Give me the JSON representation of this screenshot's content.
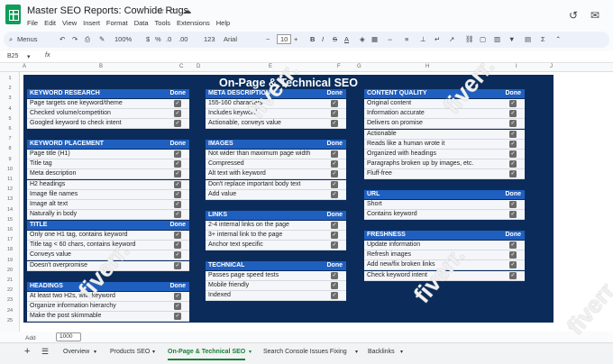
{
  "app": {
    "title": "Master SEO Reports: Cowhide Rugs"
  },
  "menu": [
    "File",
    "Edit",
    "View",
    "Insert",
    "Format",
    "Data",
    "Tools",
    "Extensions",
    "Help"
  ],
  "toolbar": {
    "menus_label": "Menus",
    "zoom": "100%",
    "percent": "%",
    "dec0": ".0",
    "dec00": ".00",
    "num_format": "123",
    "font": "Arial",
    "font_size": "10"
  },
  "formula": {
    "cell_ref": "B25"
  },
  "columns": [
    "A",
    "B",
    "C",
    "D",
    "E",
    "F",
    "G",
    "H",
    "I",
    "J"
  ],
  "rows": [
    "1",
    "2",
    "3",
    "4",
    "5",
    "6",
    "7",
    "8",
    "9",
    "10",
    "11",
    "12",
    "13",
    "14",
    "15",
    "16",
    "17",
    "18",
    "19",
    "20",
    "21",
    "22",
    "23",
    "24",
    "25"
  ],
  "sheet": {
    "title": "On-Page & Technical SEO",
    "done_label": "Done"
  },
  "sections": {
    "keyword_research": {
      "title": "KEYWORD RESEARCH",
      "items": [
        "Page targets one keyword/theme",
        "Checked volume/competition",
        "Googled keyword to check intent"
      ]
    },
    "keyword_placement": {
      "title": "KEYWORD PLACEMENT",
      "items": [
        "Page title (H1)",
        "Title tag",
        "Meta description",
        "H2 headings",
        "Image file names",
        "Image alt text",
        "Naturally in body"
      ]
    },
    "title": {
      "title": "TITLE",
      "items": [
        "Only one H1 tag, contains keyword",
        "Title tag < 60 chars, contains keyword",
        "Conveys value",
        "Doesn't overpromise"
      ]
    },
    "headings": {
      "title": "HEADINGS",
      "items": [
        "At least two H2s, with keyword",
        "Organize information hierarchy",
        "Make the post skimmable"
      ]
    },
    "meta_description": {
      "title": "META DESCRIPTION",
      "items": [
        "155-160 characters",
        "Includes keyword",
        "Actionable, conveys value"
      ]
    },
    "images": {
      "title": "IMAGES",
      "items": [
        "Not wider than maximum page width",
        "Compressed",
        "Alt text with keyword",
        "Don't replace important body text",
        "Add value"
      ]
    },
    "links": {
      "title": "LINKS",
      "items": [
        "2-4 internal links on the page",
        "3+ internal link to the page",
        "Anchor text specific"
      ]
    },
    "technical": {
      "title": "TECHNICAL",
      "items": [
        "Passes page speed tests",
        "Mobile friendly",
        "Indexed"
      ]
    },
    "content_quality": {
      "title": "CONTENT QUALITY",
      "items": [
        "Original content",
        "Information accurate",
        "Delivers on promise",
        "Actionable",
        "Reads like a human wrote it",
        "Organized with headings",
        "Paragraphs broken up by images, etc.",
        "Fluff-free"
      ]
    },
    "url": {
      "title": "URL",
      "items": [
        "Short",
        "Contains keyword"
      ]
    },
    "freshness": {
      "title": "FRESHNESS",
      "items": [
        "Update information",
        "Refresh images",
        "Add new/fix broken links",
        "Check keyword intent"
      ]
    }
  },
  "tabs": {
    "add": "+",
    "all": "☰",
    "items": [
      "Overview",
      "Products SEO",
      "On-Page & Technical SEO",
      "Search Console Issues Fixing",
      "Backlinks"
    ]
  },
  "status": {
    "zoom_box": "1000",
    "add_label": "Add"
  },
  "watermark": "fiverr."
}
